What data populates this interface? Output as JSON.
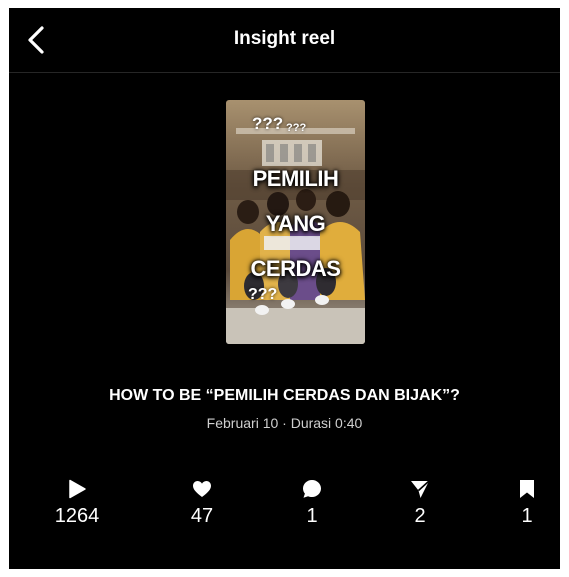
{
  "header": {
    "title": "Insight reel",
    "back_icon": "chevron-left-icon"
  },
  "thumbnail": {
    "line1": "PEMILIH",
    "line2": "YANG",
    "line3": "CERDAS",
    "qmarks_top": "???",
    "qmarks_top_small": "???",
    "qmarks_bottom": "???"
  },
  "reel": {
    "title": "HOW TO BE “PEMILIH CERDAS DAN BIJAK”?",
    "meta": "Februari 10 · Durasi 0:40"
  },
  "stats": {
    "plays": {
      "icon": "play-icon",
      "value": "1264"
    },
    "likes": {
      "icon": "heart-icon",
      "value": "47"
    },
    "comments": {
      "icon": "comment-icon",
      "value": "1"
    },
    "shares": {
      "icon": "send-icon",
      "value": "2"
    },
    "saves": {
      "icon": "bookmark-icon",
      "value": "1"
    }
  },
  "colors": {
    "background": "#000000",
    "text": "#ffffff",
    "meta_text": "#cfcfcf",
    "divider": "#262626"
  }
}
